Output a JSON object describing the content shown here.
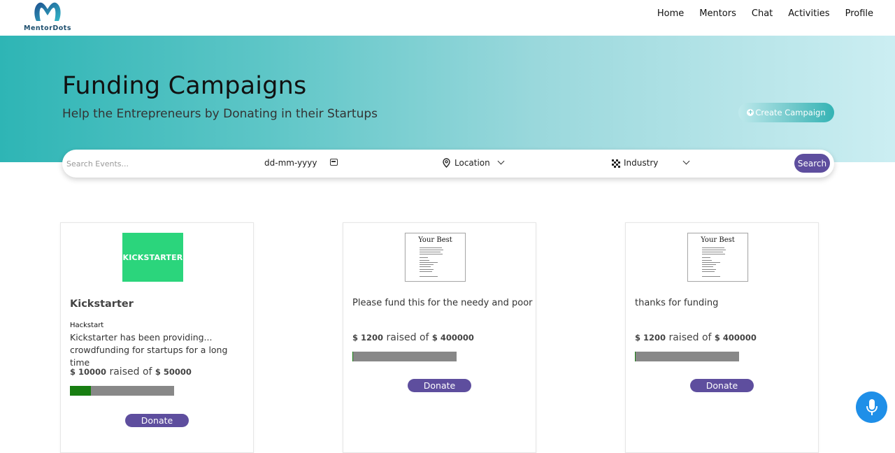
{
  "header": {
    "logo_text": "MentorDots",
    "nav": [
      "Home",
      "Mentors",
      "Chat",
      "Activities",
      "Profile"
    ]
  },
  "hero": {
    "title": "Funding Campaigns",
    "subtitle": "Help the Entrepreneurs by Donating in their Startups",
    "create_button": "Create Campaign"
  },
  "search": {
    "placeholder": "Search Events...",
    "date_placeholder": "dd-mm-yyyy",
    "location_label": "Location",
    "industry_label": "Industry",
    "button": "Search"
  },
  "campaigns": [
    {
      "image": "kickstarter-logo",
      "logo_text": "KICKSTARTER",
      "title": "Kickstarter",
      "subtitle": "Hackstart",
      "text": "Kickstarter has been providing... crowdfunding for startups for a long time",
      "raised_amount": "$ 10000",
      "raised_word": "raised of",
      "goal_amount": "$ 50000",
      "progress": 0.2,
      "donate": "Donate"
    },
    {
      "image": "poem-document",
      "doc_title": "Your Best",
      "title": "Please fund this for the needy and poor",
      "raised_amount": "$ 1200",
      "raised_word": "raised of",
      "goal_amount": "$ 400000",
      "progress": 0.003,
      "donate": "Donate"
    },
    {
      "image": "poem-document",
      "doc_title": "Your Best",
      "title": "thanks for funding",
      "raised_amount": "$ 1200",
      "raised_word": "raised of",
      "goal_amount": "$ 400000",
      "progress": 0.003,
      "donate": "Donate"
    }
  ],
  "colors": {
    "primary": "#5e4e9e",
    "hero_start": "#2eb5b5",
    "hero_end": "#cceef2",
    "progress_fill": "#187e12",
    "mic": "#1f8fe8"
  }
}
